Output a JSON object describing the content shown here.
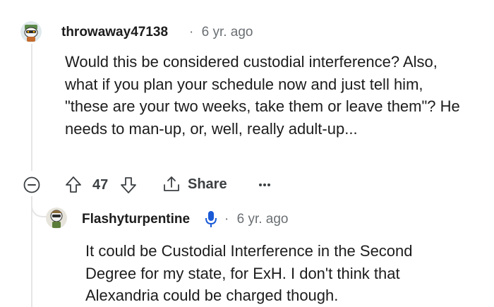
{
  "comments": [
    {
      "username": "throwaway47138",
      "time": "6 yr. ago",
      "text": "Would this be considered custodial interference? Also, what if you plan your schedule now and just tell him, \"these are your two weeks, take them or leave them\"? He needs to man-up, or, well, really adult-up...",
      "votes": "47",
      "share_label": "Share"
    },
    {
      "username": "Flashyturpentine",
      "time": "6 yr. ago",
      "text": "It could be Custodial Interference in the Second Degree for my state, for ExH. I don't think that Alexandria could be charged though."
    }
  ],
  "colors": {
    "text": "#1c1c1c",
    "meta": "#6a6f73",
    "line": "#e5e5e5",
    "mic": "#1a5ad6"
  }
}
